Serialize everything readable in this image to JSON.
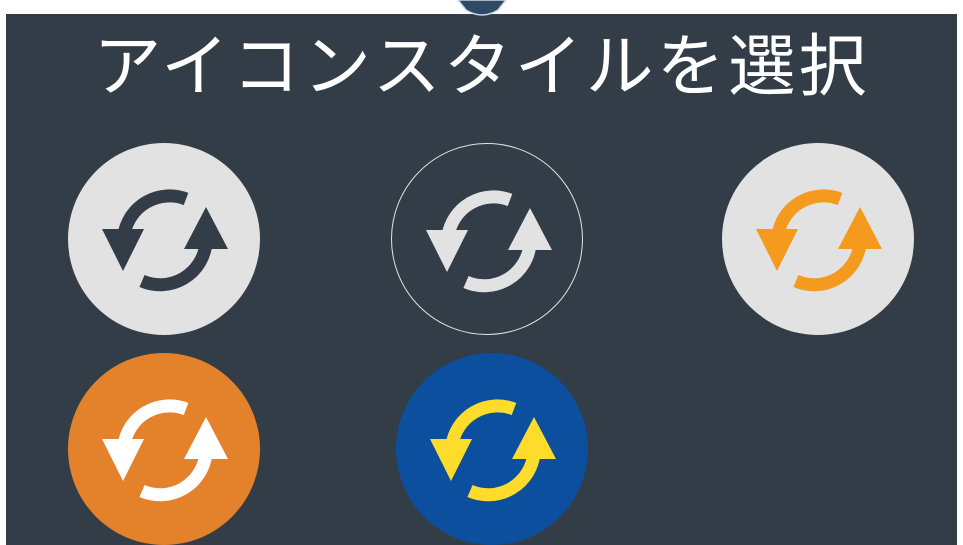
{
  "title": "アイコンスタイルを選択",
  "styles": [
    {
      "id": "style-dark-on-light",
      "icon": "refresh-icon",
      "bg": "#e2e2e2",
      "fg": "#323d47",
      "outline": "none"
    },
    {
      "id": "style-light-outline",
      "icon": "refresh-icon",
      "bg": "transparent",
      "fg": "#e2e2e2",
      "outline": "#e2e2e2"
    },
    {
      "id": "style-orange-on-light",
      "icon": "refresh-icon",
      "bg": "#e2e2e2",
      "fg": "#f39a1f",
      "outline": "none"
    },
    {
      "id": "style-white-on-orange",
      "icon": "refresh-icon",
      "bg": "#e4812b",
      "fg": "#ffffff",
      "outline": "none"
    },
    {
      "id": "style-yellow-on-blue",
      "icon": "refresh-icon",
      "bg": "#0b4f9e",
      "fg": "#ffdc2b",
      "outline": "none"
    }
  ]
}
